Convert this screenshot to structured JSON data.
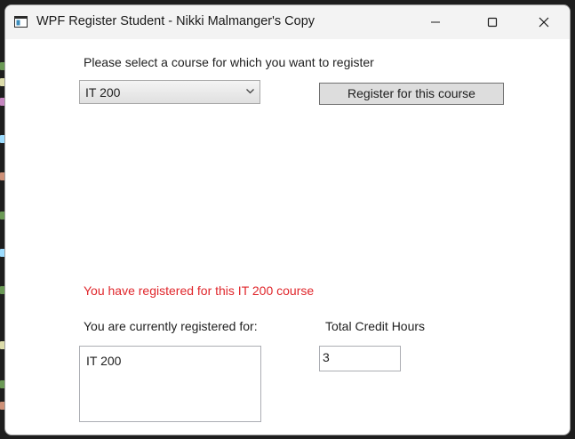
{
  "window": {
    "title": "WPF Register Student - Nikki Malmanger's Copy"
  },
  "form": {
    "prompt": "Please select a course for which you want to register",
    "course_select": {
      "selected": "IT 200"
    },
    "register_button": "Register for this course",
    "status_message": "You have registered for this IT 200 course",
    "registered_label": "You are currently registered for:",
    "registered_courses": [
      "IT 200"
    ],
    "credit_hours_label": "Total Credit Hours",
    "credit_hours_value": "3"
  },
  "colors": {
    "status_message": "#e0262b",
    "window_background": "#ffffff",
    "titlebar_background": "#f3f3f3"
  },
  "icons": {
    "app": "wpf-window-icon",
    "minimize": "minimize-icon",
    "maximize": "maximize-icon",
    "close": "close-icon",
    "dropdown": "chevron-down-icon"
  }
}
